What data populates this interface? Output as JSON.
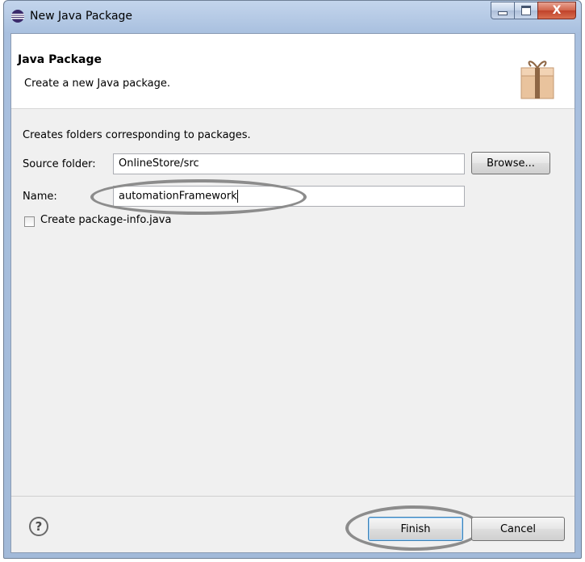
{
  "window": {
    "title": "New Java Package",
    "close_label": "X"
  },
  "header": {
    "title": "Java Package",
    "subtitle": "Create a new Java package.",
    "icon": "package-icon"
  },
  "form": {
    "description": "Creates folders corresponding to packages.",
    "source_folder_label": "Source folder:",
    "source_folder_value": "OnlineStore/src",
    "browse_label": "Browse...",
    "name_label": "Name:",
    "name_value": "automationFramework",
    "checkbox_label": "Create package-info.java",
    "checkbox_checked": false
  },
  "footer": {
    "help_label": "?",
    "finish_label": "Finish",
    "cancel_label": "Cancel"
  }
}
